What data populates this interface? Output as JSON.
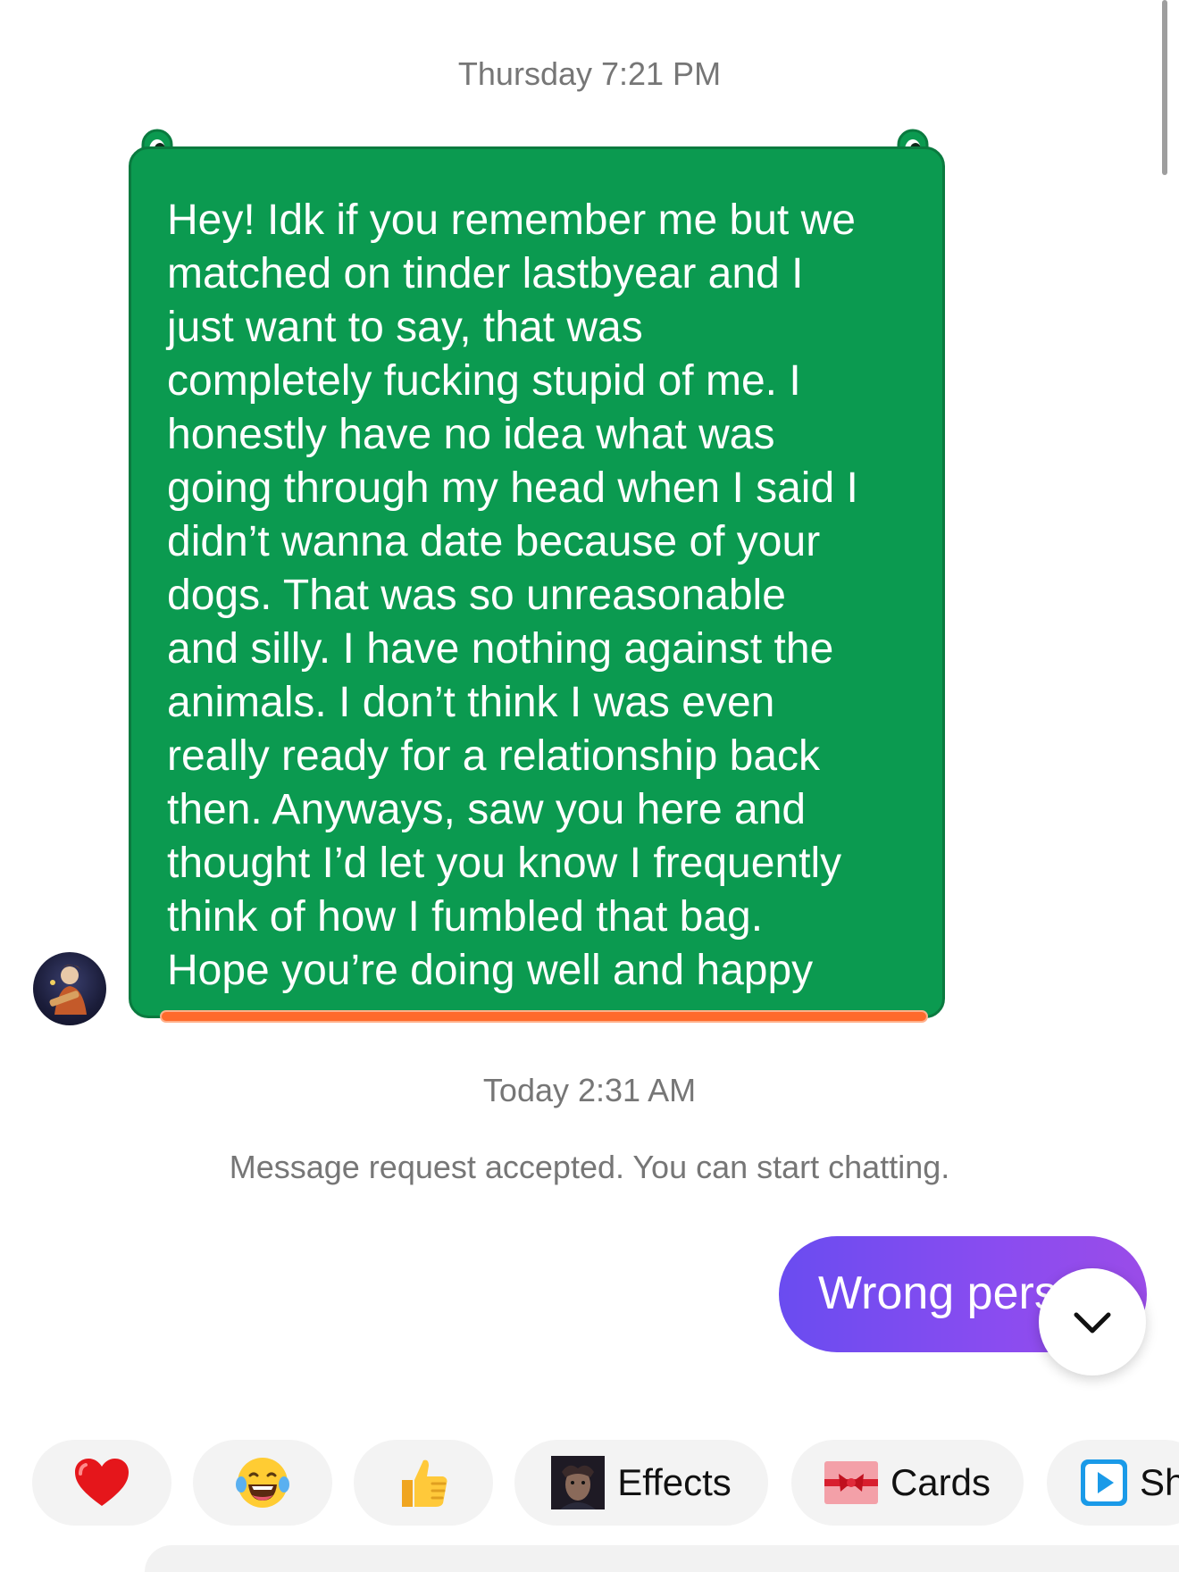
{
  "timestamps": {
    "first": "Thursday 7:21 PM",
    "second": "Today 2:31 AM"
  },
  "received_message": {
    "text": "Hey! Idk if you remember me but we\nmatched on tinder lastbyear and I\njust want to say, that was\ncompletely fucking stupid of me.  I\nhonestly have no idea what was\ngoing through my head when I said I\ndidn’t wanna date because of your\ndogs. That was so unreasonable\nand silly. I have nothing against the\nanimals. I don’t think I was even\nreally ready for a relationship back\nthen. Anyways, saw you here and\nthought I’d let you know I frequently\nthink of how I fumbled that bag.\nHope you’re doing well and happy",
    "card_color": "#0b9a50",
    "underline_color": "#ff6a2c"
  },
  "system_note": "Message request accepted. You can start chatting.",
  "sent_message": {
    "text": "Wrong pers",
    "bubble_color": "#7a4cf0"
  },
  "scroll_button": {
    "icon": "chevron-down-icon"
  },
  "quick_replies": [
    {
      "icon": "heart-icon",
      "label": ""
    },
    {
      "icon": "laughing-emoji-icon",
      "label": ""
    },
    {
      "icon": "thumbs-up-icon",
      "label": ""
    },
    {
      "icon": "effects-icon",
      "label": "Effects"
    },
    {
      "icon": "cards-icon",
      "label": "Cards"
    },
    {
      "icon": "play-icon",
      "label": "Sh"
    }
  ]
}
